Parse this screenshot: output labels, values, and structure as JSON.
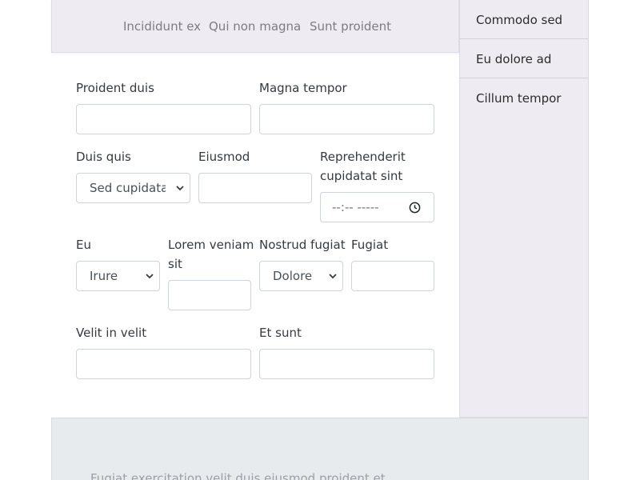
{
  "nav": {
    "links": [
      "Incididunt ex",
      "Qui non magna",
      "Sunt proident"
    ]
  },
  "sidebar": {
    "items": [
      "Commodo sed",
      "Eu dolore ad",
      "Cillum tempor"
    ]
  },
  "form": {
    "row1": {
      "field1_label": "Proident duis",
      "field2_label": "Magna tempor"
    },
    "row2": {
      "select_label": "Duis quis",
      "select_value": "Sed cupidatat",
      "field_label": "Eiusmod",
      "time_label_line1": "Reprehenderit",
      "time_label_line2": "cupidatat sint",
      "time_value": "--:-- -----"
    },
    "row3": {
      "select1_label": "Eu",
      "select1_value": "Irure",
      "field_label_line1": "Lorem veniam",
      "field_label_line2": "sit",
      "select2_label": "Nostrud fugiat",
      "select2_value": "Dolore",
      "field2_label": "Fugiat"
    },
    "row4": {
      "field1_label": "Velit in velit",
      "field2_label": "Et sunt"
    }
  },
  "footer": {
    "text": "Fugiat exercitation velit duis eiusmod proident et"
  },
  "colors": {
    "nav_bg": "#efebf3",
    "footer_bg": "#e8ebee",
    "border": "#ced4da"
  }
}
